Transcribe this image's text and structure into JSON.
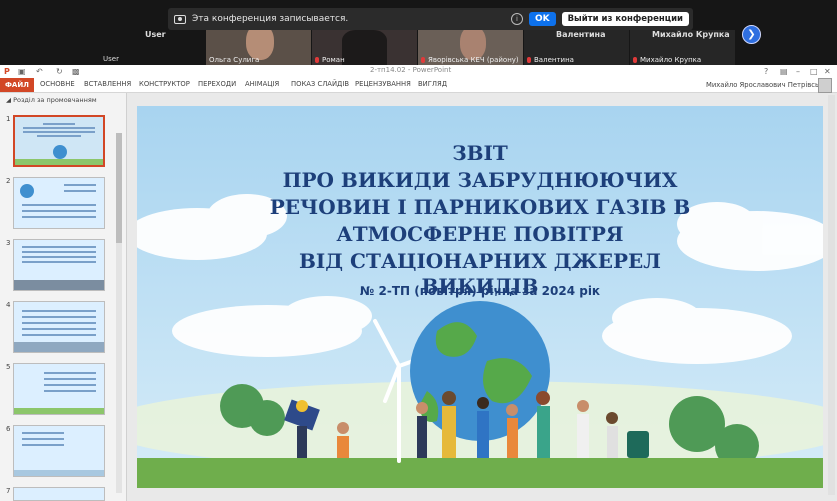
{
  "zoom": {
    "banner_text": "Эта конференция записывается.",
    "ok_label": "OK",
    "leave_label": "Выйти из конференции",
    "user_label_top": "User",
    "user_label_bottom": "User",
    "tiles": [
      {
        "name": "Ольга Сулига"
      },
      {
        "name": "Роман"
      },
      {
        "name": "Яворівська КЕЧ (району)"
      },
      {
        "name": "Валентина"
      },
      {
        "name": "Михайло Крупка"
      }
    ],
    "big_names": [
      "Валентина",
      "Михайло Крупка"
    ],
    "next_icon": "chevron-right-icon"
  },
  "ppt": {
    "doc_title": "2-тп14.02 - PowerPoint",
    "file_tab": "ФАЙЛ",
    "tabs": [
      "ОСНОВНЕ",
      "ВСТАВЛЕННЯ",
      "КОНСТРУКТОР",
      "ПЕРЕХОДИ",
      "АНІМАЦІЯ",
      "ПОКАЗ СЛАЙДІВ",
      "РЕЦЕНЗУВАННЯ",
      "ВИГЛЯД"
    ],
    "user_name": "Михайло Ярославович Петрівський",
    "section_label": "Розділ за промовчанням",
    "thumbnail_numbers": [
      "1",
      "2",
      "3",
      "4",
      "5",
      "6",
      "7"
    ],
    "accent_color": "#d24726"
  },
  "slide": {
    "title_lines": [
      "ЗВІТ",
      "ПРО ВИКИДИ ЗАБРУДНЮЮЧИХ",
      "РЕЧОВИН І ПАРНИКОВИХ ГАЗІВ В",
      "АТМОСФЕРНЕ ПОВІТРЯ",
      "ВІД СТАЦІОНАРНИХ ДЖЕРЕЛ",
      "ВИКИДІВ"
    ],
    "subtitle": "№ 2-ТП (повітря) річна за 2024 рік"
  }
}
